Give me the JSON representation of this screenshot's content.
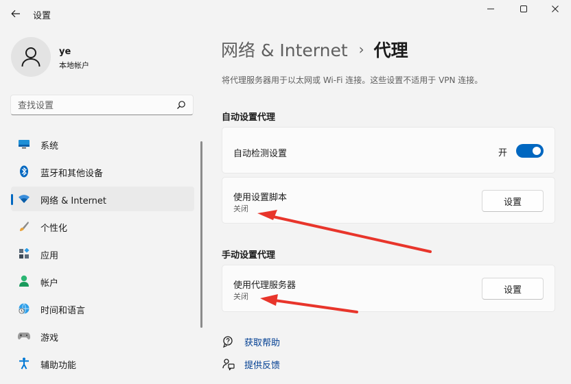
{
  "window": {
    "title": "设置",
    "controls": [
      "minimize-icon",
      "maximize-icon",
      "close-icon"
    ]
  },
  "user": {
    "name": "ye",
    "account_type": "本地帐户"
  },
  "search": {
    "placeholder": "查找设置"
  },
  "sidebar": {
    "items": [
      {
        "label": "系统",
        "icon": "system-icon",
        "active": false
      },
      {
        "label": "蓝牙和其他设备",
        "icon": "bluetooth-icon",
        "active": false
      },
      {
        "label": "网络 & Internet",
        "icon": "wifi-icon",
        "active": true
      },
      {
        "label": "个性化",
        "icon": "brush-icon",
        "active": false
      },
      {
        "label": "应用",
        "icon": "apps-icon",
        "active": false
      },
      {
        "label": "帐户",
        "icon": "account-icon",
        "active": false
      },
      {
        "label": "时间和语言",
        "icon": "time-language-icon",
        "active": false
      },
      {
        "label": "游戏",
        "icon": "gaming-icon",
        "active": false
      },
      {
        "label": "辅助功能",
        "icon": "accessibility-icon",
        "active": false
      }
    ]
  },
  "breadcrumb": {
    "parent": "网络 & Internet",
    "separator": "›",
    "current": "代理"
  },
  "description": "将代理服务器用于以太网或 Wi-Fi 连接。这些设置不适用于 VPN 连接。",
  "auto_proxy": {
    "title": "自动设置代理",
    "detect": {
      "label": "自动检测设置",
      "state_text": "开",
      "on": true
    },
    "script": {
      "label": "使用设置脚本",
      "status": "关闭",
      "button": "设置"
    }
  },
  "manual_proxy": {
    "title": "手动设置代理",
    "server": {
      "label": "使用代理服务器",
      "status": "关闭",
      "button": "设置"
    }
  },
  "links": {
    "help": "获取帮助",
    "feedback": "提供反馈"
  },
  "colors": {
    "accent": "#0067c0",
    "annotation_arrow": "#e8352b",
    "link": "#003e92"
  }
}
